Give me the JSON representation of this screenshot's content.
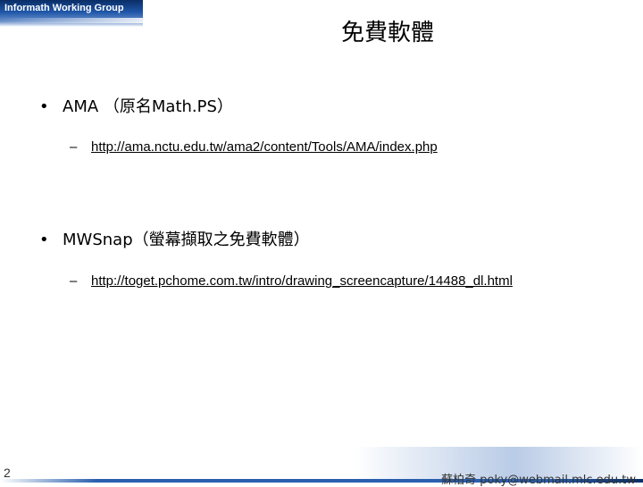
{
  "header": {
    "group": "Informath Working Group"
  },
  "title": "免費軟體",
  "bullets": [
    {
      "text": "AMA （原名Math.PS）",
      "link": "http://ama.nctu.edu.tw/ama2/content/Tools/AMA/index.php"
    },
    {
      "text": "MWSnap（螢幕擷取之免費軟體）",
      "link": "http://toget.pchome.com.tw/intro/drawing_screencapture/14488_dl.html"
    }
  ],
  "symbols": {
    "bullet": "•",
    "dash": "–"
  },
  "footer": {
    "page": "2",
    "author": "蘇柏奇 poky@webmail.mlc.edu.tw"
  },
  "colors": {
    "brand_blue": "#1e56a8",
    "dark_blue": "#0a2e66"
  }
}
